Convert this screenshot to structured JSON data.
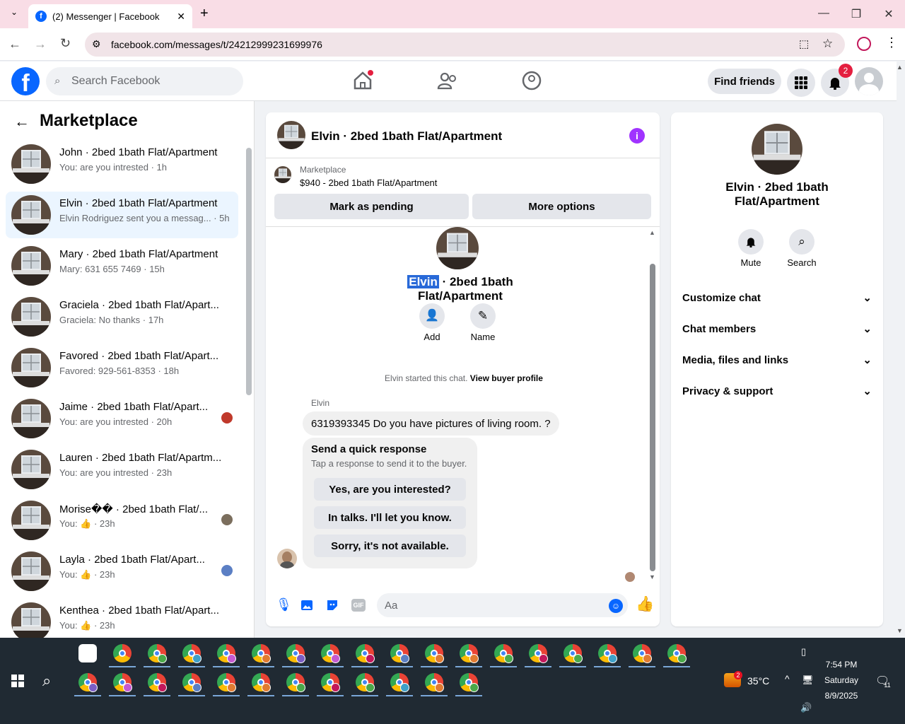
{
  "browser": {
    "tab_title": "(2) Messenger | Facebook",
    "url": "facebook.com/messages/t/24212999231699976"
  },
  "header": {
    "search_placeholder": "Search Facebook",
    "find_friends": "Find friends",
    "notif_count": "2"
  },
  "left": {
    "title": "Marketplace",
    "items": [
      {
        "name": "John · 2bed 1bath Flat/Apartment",
        "sub": "You: are you intrested · 1h"
      },
      {
        "name": "Elvin · 2bed 1bath Flat/Apartment",
        "sub": "Elvin Rodriguez sent you a messag... · 5h"
      },
      {
        "name": "Mary · 2bed 1bath Flat/Apartment",
        "sub": "Mary: 631 655 7469 · 15h"
      },
      {
        "name": "Graciela · 2bed 1bath Flat/Apart...",
        "sub": "Graciela: No thanks · 17h"
      },
      {
        "name": "Favored · 2bed 1bath Flat/Apart...",
        "sub": "Favored: 929-561-8353 · 18h"
      },
      {
        "name": "Jaime · 2bed 1bath Flat/Apart...",
        "sub": "You: are you intrested · 20h"
      },
      {
        "name": "Lauren · 2bed 1bath Flat/Apartm...",
        "sub": "You: are you intrested · 23h"
      },
      {
        "name": "Morise�� · 2bed 1bath Flat/...",
        "sub": "You: 👍 · 23h"
      },
      {
        "name": "Layla · 2bed 1bath Flat/Apart...",
        "sub": "You: 👍 · 23h"
      },
      {
        "name": "Kenthea · 2bed 1bath Flat/Apart...",
        "sub": "You: 👍 · 23h"
      }
    ]
  },
  "chat": {
    "title": "Elvin · 2bed 1bath Flat/Apartment",
    "market_label": "Marketplace",
    "listing": "$940 - 2bed 1bath Flat/Apartment",
    "mark_pending": "Mark as pending",
    "more_options": "More options",
    "profile_first": "Elvin",
    "profile_rest": " · 2bed 1bath Flat/Apartment",
    "add": "Add",
    "name": "Name",
    "started": "Elvin started this chat.",
    "view_profile": "View buyer profile",
    "sender": "Elvin",
    "message": "6319393345 Do you have pictures of living room. ?",
    "quick_title": "Send a quick response",
    "quick_sub": "Tap a response to send it to the buyer.",
    "quick": [
      "Yes, are you interested?",
      "In talks. I'll let you know.",
      "Sorry, it's not available."
    ],
    "input_placeholder": "Aa"
  },
  "right": {
    "title": "Elvin · 2bed 1bath Flat/Apartment",
    "mute": "Mute",
    "search": "Search",
    "sections": [
      "Customize chat",
      "Chat members",
      "Media, files and links",
      "Privacy & support"
    ]
  },
  "taskbar": {
    "temp": "35°C",
    "time": "7:54 PM",
    "day": "Saturday",
    "date": "8/9/2025",
    "weather_badge": "2",
    "notif_badge": "11"
  }
}
